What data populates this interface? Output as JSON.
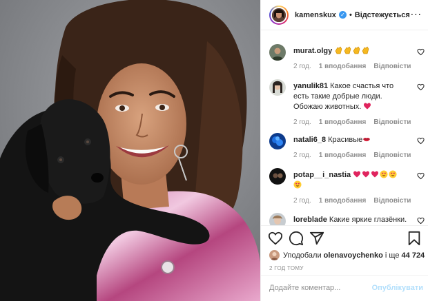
{
  "photo": {
    "alt_icon": "photo-woman-with-black-puppy"
  },
  "header": {
    "username": "kamenskux",
    "verified_icon": "verified-badge-icon",
    "separator": "•",
    "follow_status": "Відстежується",
    "more_icon": "more-options-icon",
    "more_glyph": "···"
  },
  "comments": [
    {
      "user": "murat.olgy",
      "text": "",
      "emojis": [
        "clap",
        "clap",
        "clap",
        "clap"
      ],
      "time": "2 год.",
      "likes": "1 вподобання",
      "reply": "Відповісти"
    },
    {
      "user": "yanulik81",
      "text": "Какое счастья что есть такие добрые люди. Обожаю животных.",
      "emojis": [
        "red-heart"
      ],
      "time": "2 год.",
      "likes": "1 вподобання",
      "reply": "Відповісти"
    },
    {
      "user": "natali6_8",
      "text": "Красивые",
      "emojis": [
        "lips"
      ],
      "time": "2 год.",
      "likes": "1 вподобання",
      "reply": "Відповісти"
    },
    {
      "user": "potap__i_nastia",
      "text": "",
      "emojis": [
        "red-heart",
        "red-heart",
        "red-heart",
        "heart-eyes",
        "heart-eyes",
        "heart-eyes"
      ],
      "time": "2 год.",
      "likes": "1 вподобання",
      "reply": "Відповісти"
    },
    {
      "user": "loreblade",
      "text": "Какие яркие глазёнки.",
      "emojis": [],
      "time": "",
      "likes": "",
      "reply": ""
    }
  ],
  "actions": {
    "like_icon": "heart-icon",
    "comment_icon": "comment-icon",
    "share_icon": "share-icon",
    "save_icon": "bookmark-icon"
  },
  "likes": {
    "prefix": "Уподобали",
    "user": "olenavoychenko",
    "middle": "і ще",
    "count": "44 724"
  },
  "timestamp": "2 ГОД ТОМУ",
  "add_comment": {
    "placeholder": "Додайте коментар...",
    "post_label": "Опублікувати"
  },
  "colors": {
    "link_blue": "#3897f0",
    "post_disabled": "#b2dffc",
    "muted": "#8e8e8e",
    "heart_red": "#ed4956"
  }
}
